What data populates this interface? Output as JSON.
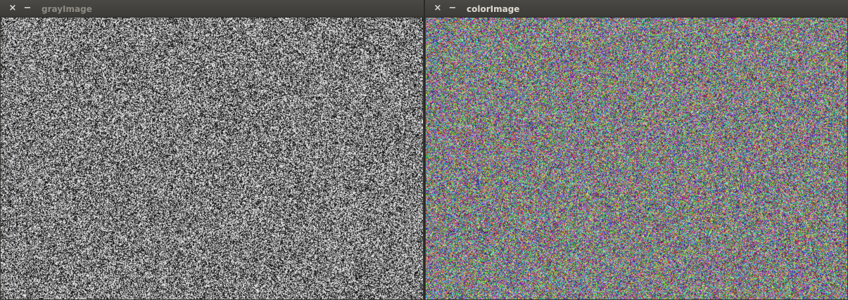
{
  "windows": [
    {
      "title": "grayImage",
      "close_icon": "close-icon",
      "minimize_icon": "minimize-icon",
      "image_kind": "gray-noise"
    },
    {
      "title": "colorImage",
      "close_icon": "close-icon",
      "minimize_icon": "minimize-icon",
      "image_kind": "color-noise"
    }
  ],
  "glyphs": {
    "close": "×",
    "minimize": "−"
  }
}
